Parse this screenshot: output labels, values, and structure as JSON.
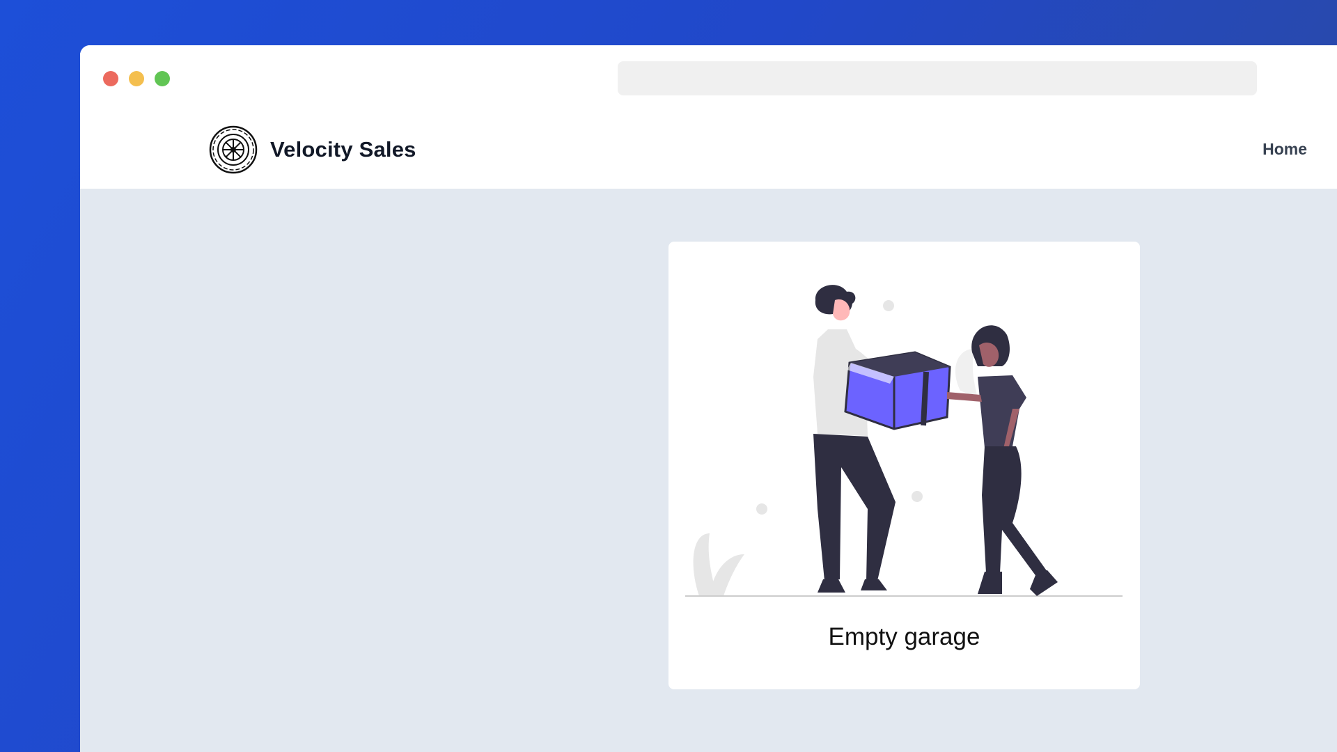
{
  "app": {
    "brand_name": "Velocity Sales",
    "logo_icon": "tire-wheel-icon"
  },
  "nav": {
    "home_label": "Home"
  },
  "browser": {
    "url": ""
  },
  "empty_state": {
    "title": "Empty garage",
    "illustration": "people-exchanging-box-illustration"
  },
  "colors": {
    "background_gradient_start": "#1d4fd8",
    "page_bg": "#e2e8f0",
    "accent": "#6c63ff",
    "dark_figure": "#2f2e41"
  }
}
